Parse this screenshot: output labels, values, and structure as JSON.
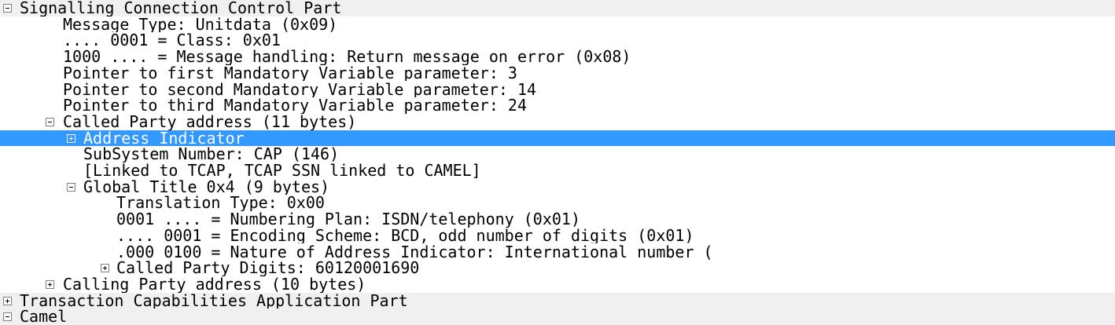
{
  "tree": [
    {
      "text": "Signalling Connection Control Part",
      "toggle": "collapse"
    },
    {
      "text": "Message Type: Unitdata (0x09)"
    },
    {
      "text": ".... 0001 = Class: 0x01"
    },
    {
      "text": "1000 .... = Message handling: Return message on error (0x08)"
    },
    {
      "text": "Pointer to first Mandatory Variable parameter: 3"
    },
    {
      "text": "Pointer to second Mandatory Variable parameter: 14"
    },
    {
      "text": "Pointer to third Mandatory Variable parameter: 24"
    },
    {
      "text": "Called Party address (11 bytes)",
      "toggle": "collapse"
    },
    {
      "text": "Address Indicator",
      "toggle": "expand"
    },
    {
      "text": "SubSystem Number: CAP (146)"
    },
    {
      "text": "[Linked to TCAP, TCAP SSN linked to CAMEL]"
    },
    {
      "text": "Global Title 0x4 (9 bytes)",
      "toggle": "collapse"
    },
    {
      "text": "Translation Type: 0x00"
    },
    {
      "text": "0001 .... = Numbering Plan: ISDN/telephony (0x01)"
    },
    {
      "text": ".... 0001 = Encoding Scheme: BCD, odd number of digits (0x01)"
    },
    {
      "text": ".000 0100 = Nature of Address Indicator: International number ("
    },
    {
      "text": "Called Party Digits: 60120001690",
      "toggle": "expand"
    },
    {
      "text": "Calling Party address (10 bytes)",
      "toggle": "expand"
    },
    {
      "text": "Transaction Capabilities Application Part",
      "toggle": "expand"
    },
    {
      "text": "Camel",
      "toggle": "collapse"
    }
  ]
}
